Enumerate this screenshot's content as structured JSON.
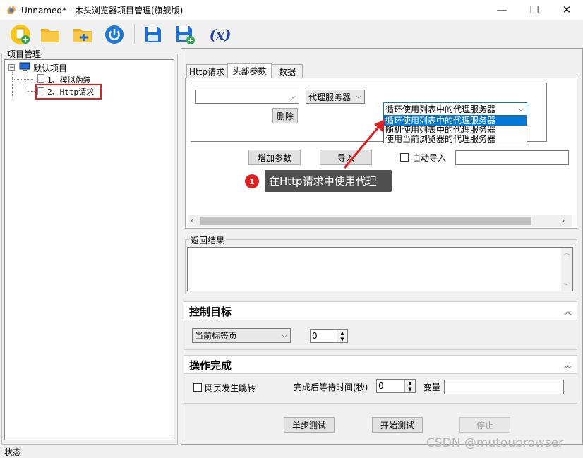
{
  "window": {
    "title": "Unnamed* - 木头浏览器项目管理(旗舰版)",
    "minimize_glyph": "—",
    "maximize_glyph": "☐",
    "close_glyph": "✕"
  },
  "toolbar": {
    "buttons": [
      {
        "name": "new-project-icon"
      },
      {
        "name": "open-folder-icon"
      },
      {
        "name": "add-folder-icon"
      },
      {
        "name": "power-icon"
      },
      {
        "name": "save-icon"
      },
      {
        "name": "save-as-icon"
      },
      {
        "name": "variable-icon",
        "label": "(x)"
      }
    ]
  },
  "project_panel": {
    "title": "项目管理",
    "root": "默认项目",
    "items": [
      "1、模拟伪装",
      "2、Http请求"
    ]
  },
  "tabs": [
    "Http请求",
    "头部参数",
    "数据"
  ],
  "headers_tab": {
    "param_combo_value": "",
    "proxy_type": "代理服务器",
    "proxy_mode_selected": "循环使用列表中的代理服务器",
    "proxy_mode_options": [
      "循环使用列表中的代理服务器",
      "随机使用列表中的代理服务器",
      "使用当前浏览器的代理服务器"
    ],
    "delete_label": "删除",
    "add_param_label": "增加参数",
    "import_label": "导入",
    "auto_import_label": "自动导入",
    "auto_import_value": ""
  },
  "annotation": {
    "badge": "1",
    "text": "在Http请求中使用代理"
  },
  "result": {
    "label": "返回结果",
    "value": ""
  },
  "control_target": {
    "title": "控制目标",
    "tab_select": "当前标签页",
    "index": "0"
  },
  "operation_done": {
    "title": "操作完成",
    "page_jump_label": "网页发生跳转",
    "wait_label": "完成后等待时间(秒)",
    "wait_value": "0",
    "variable_label": "变量",
    "variable_value": ""
  },
  "actions": {
    "step_test": "单步测试",
    "start_test": "开始测试",
    "stop": "停止"
  },
  "status": {
    "text": "状态"
  },
  "watermark": "CSDN @mutoubrowser",
  "colors": {
    "accent": "#0078d7",
    "highlight_red": "#e02020"
  }
}
